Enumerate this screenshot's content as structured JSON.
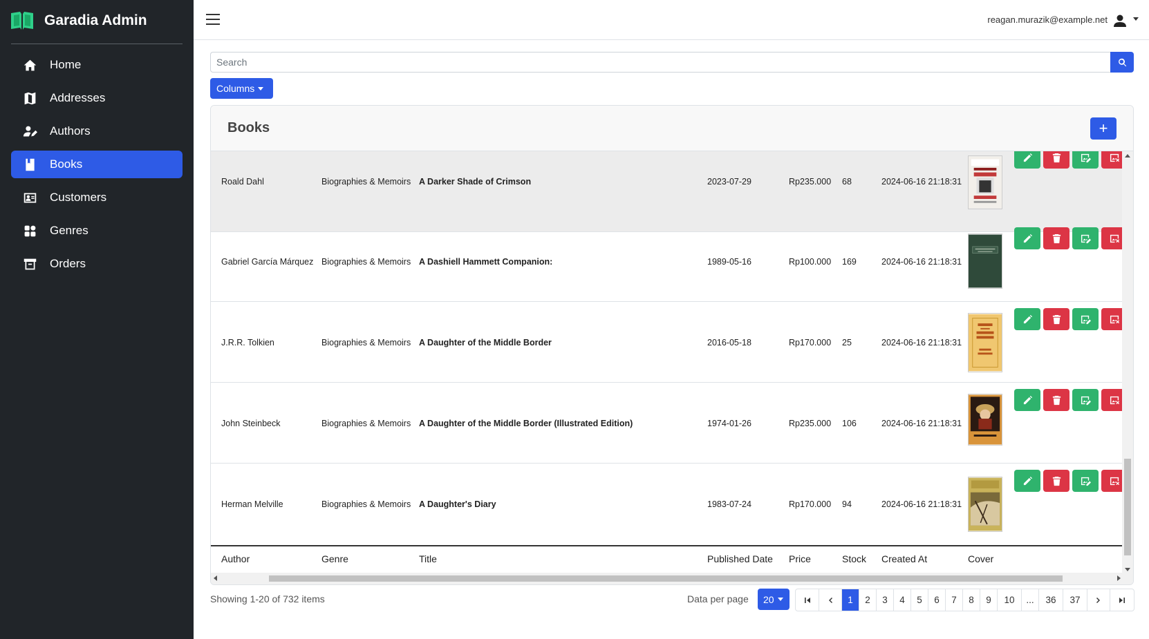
{
  "app": {
    "title": "Garadia Admin",
    "user_email": "reagan.murazik@example.net"
  },
  "sidebar": {
    "items": [
      {
        "label": "Home",
        "icon": "home-icon"
      },
      {
        "label": "Addresses",
        "icon": "map-icon"
      },
      {
        "label": "Authors",
        "icon": "author-icon"
      },
      {
        "label": "Books",
        "icon": "book-icon",
        "active": true
      },
      {
        "label": "Customers",
        "icon": "customer-icon"
      },
      {
        "label": "Genres",
        "icon": "genres-icon"
      },
      {
        "label": "Orders",
        "icon": "orders-icon"
      }
    ]
  },
  "search": {
    "placeholder": "Search",
    "value": ""
  },
  "toolbar": {
    "columns_label": "Columns"
  },
  "card": {
    "title": "Books",
    "add_label": "+"
  },
  "table": {
    "headers": [
      "Author",
      "Genre",
      "Title",
      "Published Date",
      "Price",
      "Stock",
      "Created At",
      "Cover"
    ],
    "rows": [
      {
        "author": "Roald Dahl",
        "genre": "Biographies & Memoirs",
        "title": "A Darker Shade of Crimson",
        "published": "2023-07-29",
        "price": "Rp235.000",
        "stock": "68",
        "created": "2024-06-16 21:18:31",
        "cover": "crimson"
      },
      {
        "author": "Gabriel García Márquez",
        "genre": "Biographies & Memoirs",
        "title": "A Dashiell Hammett Companion:",
        "published": "1989-05-16",
        "price": "Rp100.000",
        "stock": "169",
        "created": "2024-06-16 21:18:31",
        "cover": "green"
      },
      {
        "author": "J.R.R. Tolkien",
        "genre": "Biographies & Memoirs",
        "title": "A Daughter of the Middle Border",
        "published": "2016-05-18",
        "price": "Rp170.000",
        "stock": "25",
        "created": "2024-06-16 21:18:31",
        "cover": "yellow"
      },
      {
        "author": "John Steinbeck",
        "genre": "Biographies & Memoirs",
        "title": "A Daughter of the Middle Border (Illustrated Edition)",
        "published": "1974-01-26",
        "price": "Rp235.000",
        "stock": "106",
        "created": "2024-06-16 21:18:31",
        "cover": "portrait"
      },
      {
        "author": "Herman Melville",
        "genre": "Biographies & Memoirs",
        "title": "A Daughter's Diary",
        "published": "1983-07-24",
        "price": "Rp170.000",
        "stock": "94",
        "created": "2024-06-16 21:18:31",
        "cover": "landscape"
      }
    ],
    "row_actions": [
      "edit",
      "delete",
      "edit-cover",
      "delete-cover"
    ]
  },
  "footer": {
    "showing": "Showing 1-20 of 732 items",
    "data_per_page_label": "Data per page",
    "per_page": "20",
    "pages": [
      "1",
      "2",
      "3",
      "4",
      "5",
      "6",
      "7",
      "8",
      "9",
      "10",
      "...",
      "36",
      "37"
    ],
    "current_page": "1"
  },
  "colors": {
    "sidebar_bg": "#212529",
    "accent": "#2e5be6",
    "success": "#2fb36d",
    "danger": "#dc3545",
    "logo": "#2fd08a"
  }
}
